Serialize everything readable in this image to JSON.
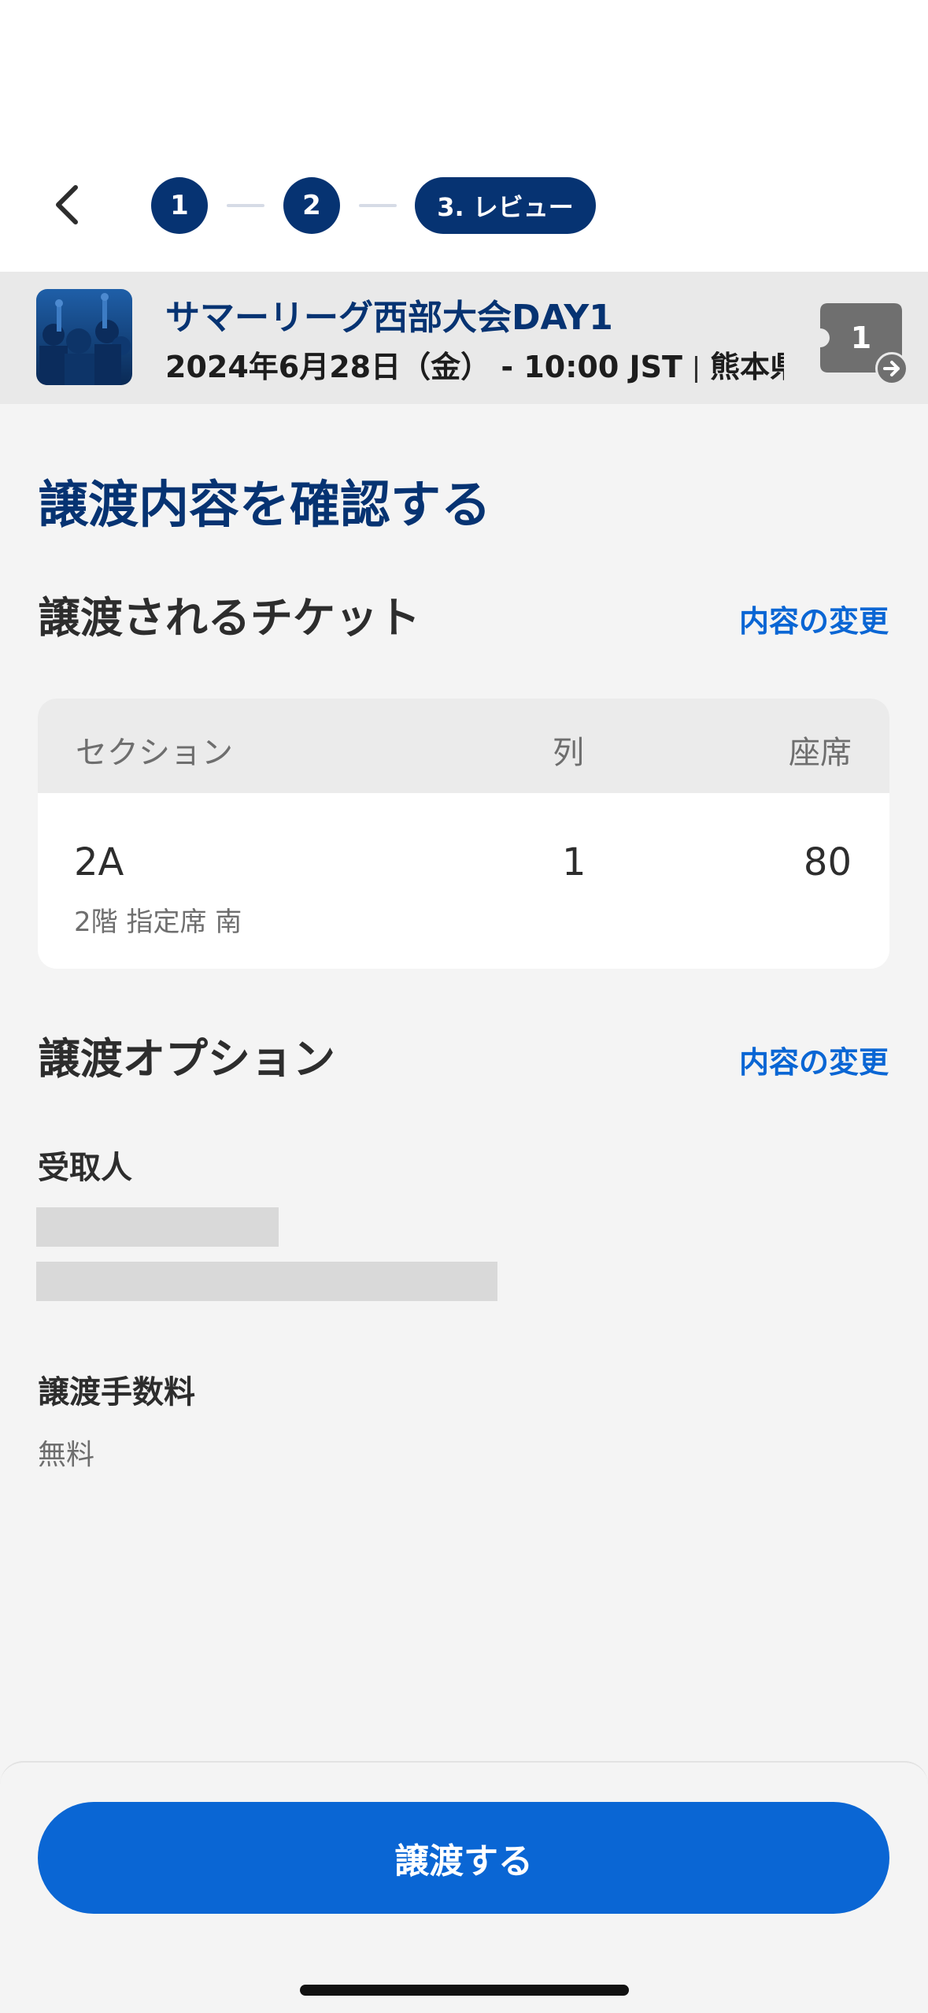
{
  "stepper": {
    "step1": "1",
    "step2": "2",
    "step3": "3. レビュー"
  },
  "event": {
    "title": "サマーリーグ西部大会DAY1",
    "date": "2024年6月28日（金） -  10:00 JST",
    "venue": "熊本県",
    "ticket_count": "1",
    "badge_color": "#6f6f6f"
  },
  "page": {
    "heading": "譲渡内容を確認する"
  },
  "tickets_section": {
    "title": "譲渡されるチケット",
    "change_link": "内容の変更",
    "columns": {
      "section": "セクション",
      "row": "列",
      "seat": "座席"
    },
    "rows": [
      {
        "section": "2A",
        "detail": "2階 指定席 南",
        "row": "1",
        "seat": "80"
      }
    ]
  },
  "options_section": {
    "title": "譲渡オプション",
    "change_link": "内容の変更",
    "recipient_label": "受取人",
    "fee_label": "譲渡手数料",
    "fee_value": "無料"
  },
  "action": {
    "transfer_button": "譲渡する"
  },
  "colors": {
    "primary_navy": "#063372",
    "accent_blue": "#0a66d4",
    "background": "#f4f4f4"
  }
}
